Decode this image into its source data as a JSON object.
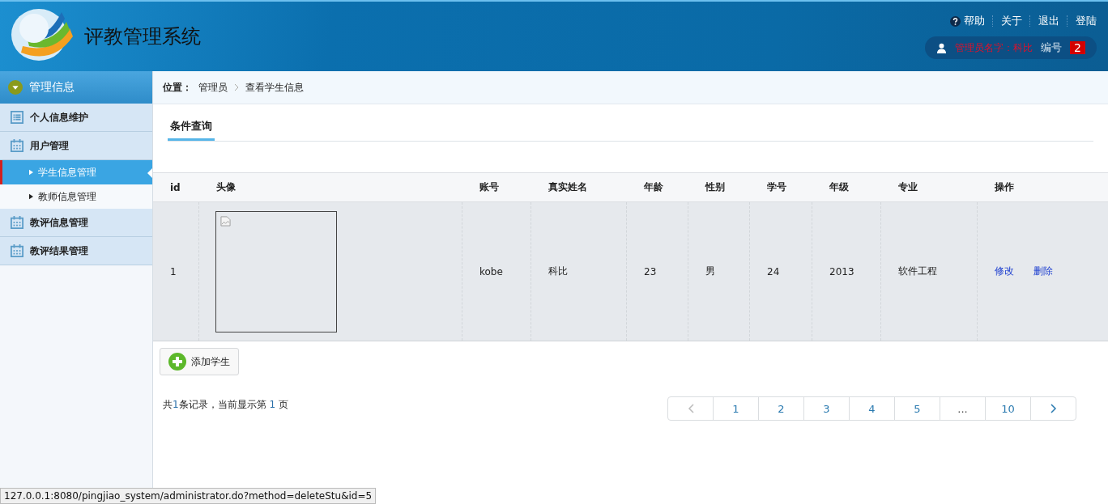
{
  "header": {
    "title": "评教管理系统",
    "links": [
      {
        "label": "帮助",
        "kind": "help"
      },
      {
        "label": "关于",
        "kind": "plain"
      },
      {
        "label": "退出",
        "kind": "plain"
      },
      {
        "label": "登陆",
        "kind": "plain"
      }
    ],
    "user": {
      "name": "管理员名字：科比",
      "id_label": "编号",
      "id_value": "2"
    }
  },
  "sidebar": {
    "title": "管理信息",
    "items": [
      {
        "label": "个人信息维护",
        "kind": "list",
        "selected": false
      },
      {
        "label": "用户管理",
        "kind": "calendar",
        "selected": false,
        "expanded": true,
        "children": [
          {
            "label": "学生信息管理",
            "selected": true
          },
          {
            "label": "教师信息管理",
            "selected": false
          }
        ]
      },
      {
        "label": "教评信息管理",
        "kind": "calendar",
        "selected": false
      },
      {
        "label": "教评结果管理",
        "kind": "calendar",
        "selected": false
      }
    ]
  },
  "breadcrumb": {
    "label": "位置：",
    "path": [
      "管理员",
      "查看学生信息"
    ]
  },
  "tabs": [
    {
      "label": "条件查询",
      "selected": true
    }
  ],
  "table": {
    "columns": [
      "id",
      "头像",
      "账号",
      "真实姓名",
      "年龄",
      "性别",
      "学号",
      "年级",
      "专业",
      "操作"
    ],
    "rows": [
      {
        "cells": [
          "1",
          {
            "kind": "picture"
          },
          "kobe",
          "科比",
          "23",
          "男",
          "24",
          "2013",
          "软件工程"
        ],
        "actions": [
          "修改",
          "删除"
        ]
      }
    ]
  },
  "add_button": {
    "label": "添加学生"
  },
  "record_summary": "共**1**条记录，当前显示第 **1** 页",
  "pagination": [
    {
      "kind": "prev",
      "disabled": true
    },
    {
      "kind": "page",
      "label": "1"
    },
    {
      "kind": "page",
      "label": "2"
    },
    {
      "kind": "page",
      "label": "3"
    },
    {
      "kind": "page",
      "label": "4"
    },
    {
      "kind": "page",
      "label": "5"
    },
    {
      "kind": "ellipsis",
      "label": "..."
    },
    {
      "kind": "page",
      "label": "10"
    },
    {
      "kind": "next",
      "disabled": false
    }
  ],
  "status_url": "127.0.0.1:8080/pingjiao_system/administrator.do?method=deleteStu&id=5"
}
